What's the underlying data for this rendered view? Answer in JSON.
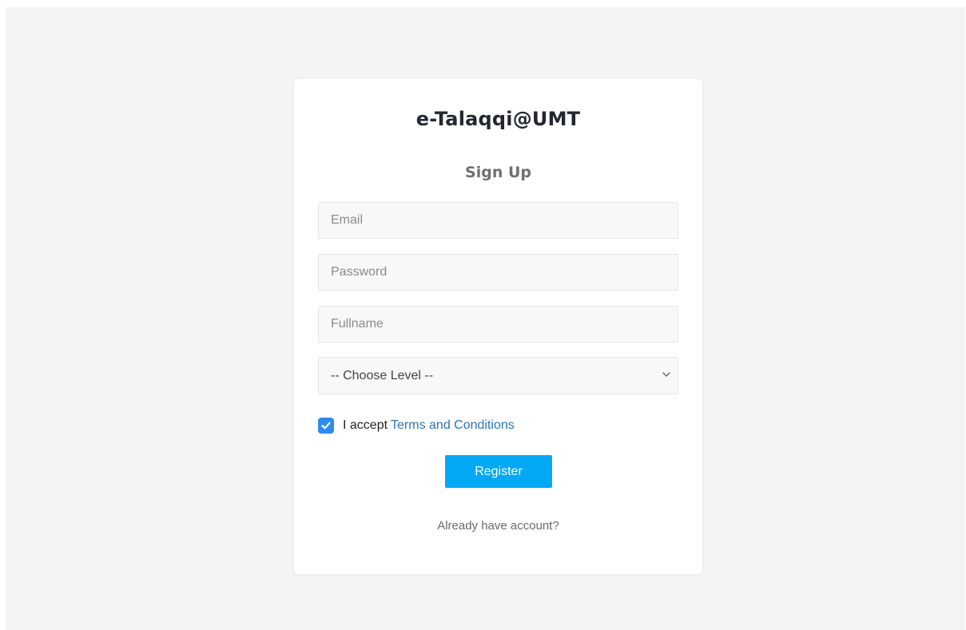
{
  "app": {
    "title": "e-Talaqqi@UMT"
  },
  "form": {
    "heading": "Sign Up",
    "email_placeholder": "Email",
    "password_placeholder": "Password",
    "fullname_placeholder": "Fullname",
    "level_select": {
      "selected": "-- Choose Level --"
    },
    "terms": {
      "checked": true,
      "prefix": "I accept",
      "link_text": "Terms and Conditions"
    },
    "register_label": "Register",
    "login_link": "Already have account?"
  },
  "icons": {
    "checkbox": "check-icon",
    "select": "chevron-down-icon"
  },
  "colors": {
    "page_background": "#f4f4f4",
    "card_background": "#ffffff",
    "primary_button": "#03a9f4",
    "checkbox": "#2d8bf0",
    "link": "#2a74b8"
  }
}
